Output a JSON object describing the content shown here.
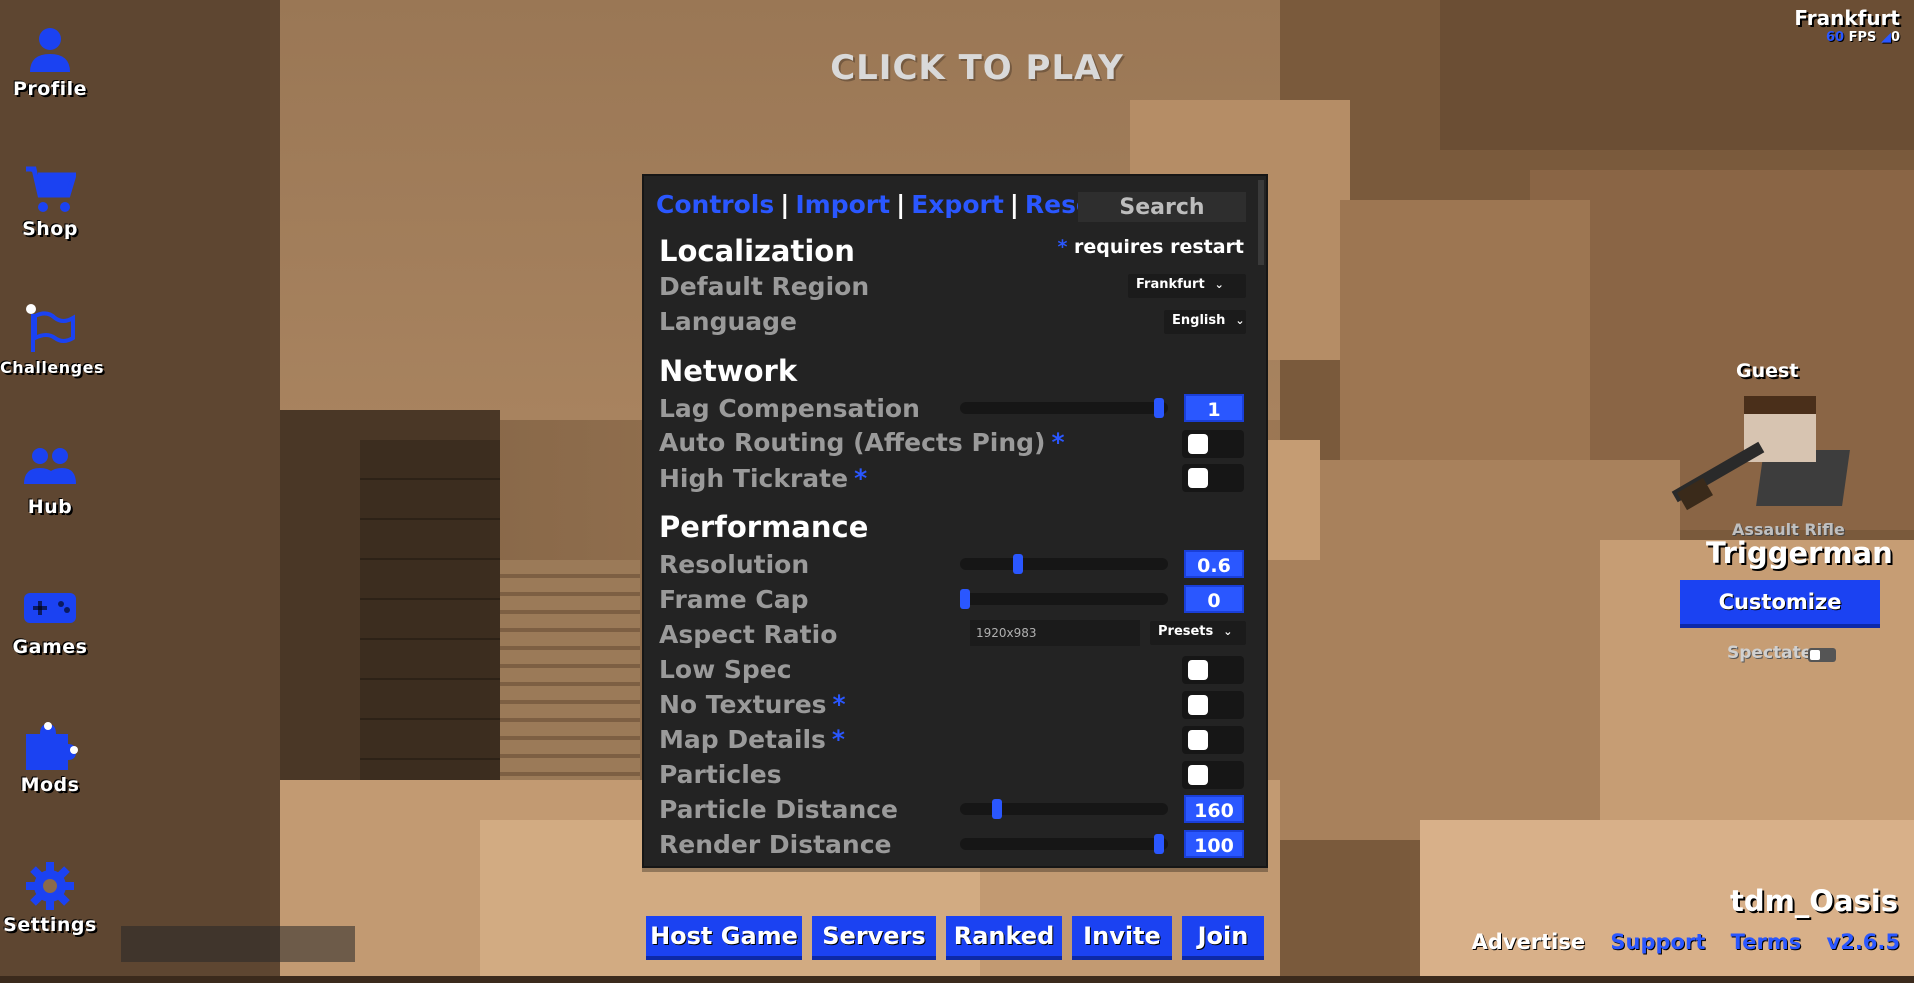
{
  "header": {
    "click_to_play": "CLICK TO PLAY"
  },
  "region_info": {
    "region": "Frankfurt",
    "fps_value": "60",
    "fps_label": "FPS",
    "ping_value": "0"
  },
  "sidebar": {
    "items": [
      {
        "label": "Profile",
        "icon": "profile-icon"
      },
      {
        "label": "Shop",
        "icon": "cart-icon"
      },
      {
        "label": "Challenges",
        "icon": "flag-icon"
      },
      {
        "label": "Hub",
        "icon": "users-icon"
      },
      {
        "label": "Games",
        "icon": "gamepad-icon"
      },
      {
        "label": "Mods",
        "icon": "puzzle-icon"
      },
      {
        "label": "Settings",
        "icon": "gear-icon"
      }
    ]
  },
  "settings": {
    "tabs": {
      "controls": "Controls",
      "import": "Import",
      "export": "Export",
      "reset": "Reset",
      "separator": "|"
    },
    "search_placeholder": "Search",
    "restart_note_star": "*",
    "restart_note": "requires restart",
    "sections": {
      "localization": "Localization",
      "network": "Network",
      "performance": "Performance"
    },
    "rows": {
      "default_region": {
        "label": "Default Region",
        "value": "Frankfurt"
      },
      "language": {
        "label": "Language",
        "value": "English"
      },
      "lag_compensation": {
        "label": "Lag Compensation",
        "value": "1",
        "slider_fraction": 0.98
      },
      "auto_routing": {
        "label": "Auto Routing (Affects Ping)",
        "star": "*",
        "checked": false
      },
      "high_tickrate": {
        "label": "High Tickrate",
        "star": "*",
        "checked": false
      },
      "resolution": {
        "label": "Resolution",
        "value": "0.6",
        "slider_fraction": 0.27
      },
      "frame_cap": {
        "label": "Frame Cap",
        "value": "0",
        "slider_fraction": 0.0
      },
      "aspect_ratio": {
        "label": "Aspect Ratio",
        "value": "1920x983",
        "preset": "Presets"
      },
      "low_spec": {
        "label": "Low Spec",
        "checked": false
      },
      "no_textures": {
        "label": "No Textures",
        "star": "*",
        "checked": false
      },
      "map_details": {
        "label": "Map Details",
        "star": "*",
        "checked": false
      },
      "particles": {
        "label": "Particles",
        "checked": false
      },
      "particle_distance": {
        "label": "Particle Distance",
        "value": "160",
        "slider_fraction": 0.16
      },
      "render_distance": {
        "label": "Render Distance",
        "value": "100",
        "slider_fraction": 0.98
      }
    }
  },
  "bottom_buttons": {
    "host_game": "Host Game",
    "servers": "Servers",
    "ranked": "Ranked",
    "invite": "Invite",
    "join": "Join"
  },
  "character": {
    "guest": "Guest",
    "weapon": "Assault Rifle",
    "class_name": "Triggerman",
    "customize": "Customize",
    "spectate": "Spectate"
  },
  "footer": {
    "username": "tdm_Oasis",
    "advertise": "Advertise",
    "support": "Support",
    "terms": "Terms",
    "version": "v2.6.5"
  },
  "colors": {
    "accent_blue": "#2a57ff",
    "button_blue": "#1b42f2",
    "panel_bg": "#232323"
  }
}
